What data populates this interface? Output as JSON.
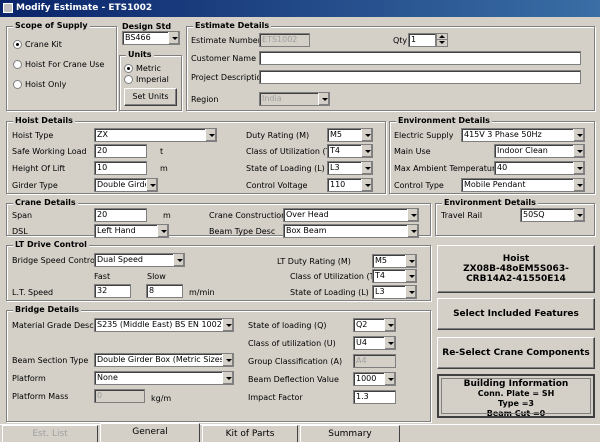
{
  "window": {
    "title": "Modify Estimate - ETS1002"
  },
  "scope": {
    "title": "Scope of Supply",
    "options": [
      "Crane Kit",
      "Hoist For Crane Use",
      "Hoist Only"
    ],
    "selected": 0
  },
  "design": {
    "title": "Design Std",
    "value": "BS466",
    "units_title": "Units",
    "units_options": [
      "Metric",
      "Imperial"
    ],
    "units_selected": 0,
    "set_units_label": "Set Units"
  },
  "estimate": {
    "title": "Estimate Details",
    "number_label": "Estimate Number",
    "number_value": "ETS1002",
    "qty_label": "Qty",
    "qty_value": "1",
    "customer_label": "Customer Name",
    "customer_value": "",
    "project_label": "Project Description",
    "project_value": "",
    "region_label": "Region",
    "region_value": "India"
  },
  "hoist": {
    "title": "Hoist Details",
    "hoist_type_label": "Hoist Type",
    "hoist_type_value": "ZX",
    "swl_label": "Safe Working Load",
    "swl_value": "20",
    "swl_unit": "t",
    "height_label": "Height Of Lift",
    "height_value": "10",
    "height_unit": "m",
    "girder_label": "Girder Type",
    "girder_value": "Double Girder",
    "duty_label": "Duty Rating (M)",
    "duty_value": "M5",
    "class_label": "Class of Utilization (T)",
    "class_value": "T4",
    "state_label": "State of Loading (L)",
    "state_value": "L3",
    "control_label": "Control Voltage",
    "control_value": "110"
  },
  "environment": {
    "title": "Environment Details",
    "supply_label": "Electric Supply",
    "supply_value": "415V 3 Phase 50Hz",
    "mainuse_label": "Main Use",
    "mainuse_value": "Indoor Clean",
    "maxtemp_label": "Max Ambient Temperature",
    "maxtemp_value": "40",
    "controltype_label": "Control Type",
    "controltype_value": "Mobile Pendant"
  },
  "crane": {
    "title": "Crane Details",
    "span_label": "Span",
    "span_value": "20",
    "span_unit": "m",
    "dsl_label": "DSL",
    "dsl_value": "Left Hand",
    "construction_label": "Crane Construction",
    "construction_value": "Over Head",
    "beam_label": "Beam Type Desc",
    "beam_value": "Box Beam"
  },
  "environment2": {
    "title": "Environment Details",
    "rail_label": "Travel Rail",
    "rail_value": "50SQ"
  },
  "lt": {
    "title": "LT Drive Control",
    "bridge_speed_label": "Bridge Speed Control",
    "bridge_speed_value": "Dual Speed",
    "fast_label": "Fast",
    "slow_label": "Slow",
    "speed_label": "L.T. Speed",
    "fast_value": "32",
    "slow_value": "8",
    "speed_unit": "m/min",
    "duty_label": "LT Duty Rating (M)",
    "duty_value": "M5",
    "class_label": "Class of Utilization (T)",
    "class_value": "T4",
    "state_label": "State of Loading (L)",
    "state_value": "L3"
  },
  "bridge": {
    "title": "Bridge Details",
    "material_label": "Material Grade Desc",
    "material_value": "S235 (Middle East) BS EN 10025",
    "section_label": "Beam Section Type",
    "section_value": "Double Girder Box (Metric Sizes)",
    "platform_label": "Platform",
    "platform_value": "None",
    "mass_label": "Platform Mass",
    "mass_value": "0",
    "mass_unit": "kg/m",
    "state_label": "State of loading (Q)",
    "state_value": "Q2",
    "class_label": "Class of utilization (U)",
    "class_value": "U4",
    "group_label": "Group Classification (A)",
    "group_value": "A4",
    "deflection_label": "Beam Deflection Value",
    "deflection_value": "1000",
    "impact_label": "Impact Factor",
    "impact_value": "1.3"
  },
  "side": {
    "hoist_lines": [
      "Hoist",
      "ZX08B-48oEM5S063-",
      "CRB14A2-41550E14"
    ],
    "select_features": "Select Included Features",
    "reselect": "Re-Select Crane Components",
    "building_lines": [
      "Building Information",
      "Conn. Plate = SH",
      "Type =3",
      "Beam Cut =0"
    ]
  },
  "tabs": [
    "Est. List",
    "General",
    "Kit of Parts",
    "Summary"
  ]
}
